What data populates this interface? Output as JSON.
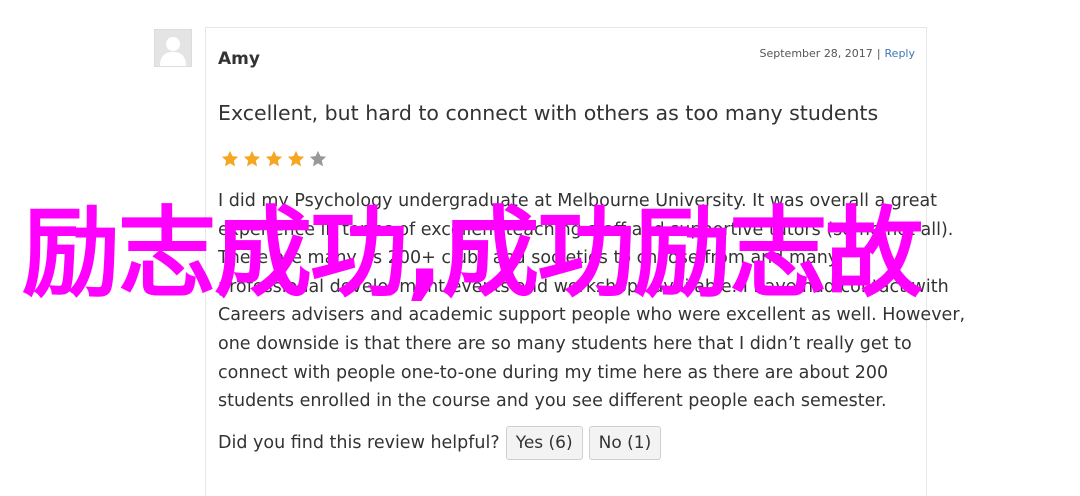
{
  "review": {
    "author": "Amy",
    "date": "September 28, 2017",
    "separator": "|",
    "reply_label": "Reply",
    "title": "Excellent, but hard to connect with others as too many students",
    "rating": 4,
    "rating_max": 5,
    "body_lines": [
      "I did my Psychology undergraduate at Melbourne University. It was overall a great",
      "experience in terms of excellent teaching staff and supportive tutors (some not all).",
      "There are many as 200+ clubs and societies to choose from and many",
      "professional development events and workshops available. I have had contact with",
      "Careers advisers and academic support people who were excellent as well. However,",
      "one downside is that there are so many students here that I didn’t really get to",
      "connect with people one-to-one during my time here as there are about 200",
      "students enrolled in the course and you see different people each semester."
    ],
    "helpful_question": "Did you find this review helpful?",
    "yes_label": "Yes (6)",
    "no_label": "No (1)"
  },
  "overlay_text": "励志成功,成功励志故",
  "colors": {
    "star_filled": "#f5a623",
    "star_empty": "#999999",
    "overlay": "#ff00ff",
    "link": "#3e78b3"
  },
  "icons": {
    "avatar": "default-user-avatar-icon",
    "star": "star-icon"
  }
}
